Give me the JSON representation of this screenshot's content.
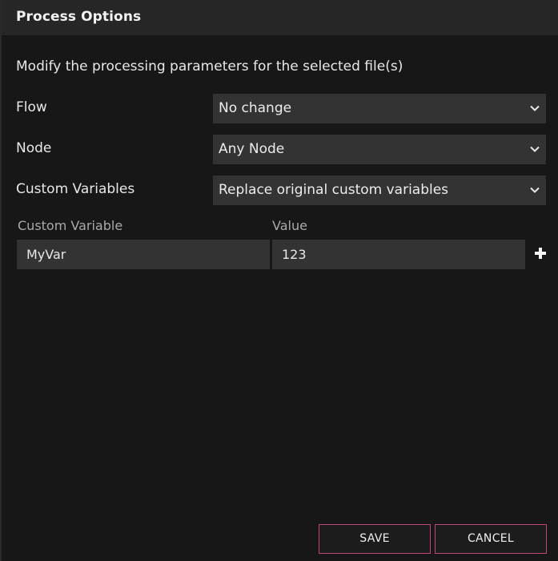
{
  "dialog": {
    "title": "Process Options",
    "description": "Modify the processing parameters for the selected file(s)"
  },
  "fields": {
    "flow": {
      "label": "Flow",
      "value": "No change"
    },
    "node": {
      "label": "Node",
      "value": "Any Node"
    },
    "custom_variables": {
      "label": "Custom Variables",
      "value": "Replace original custom variables"
    }
  },
  "variables_table": {
    "col_variable": "Custom Variable",
    "col_value": "Value",
    "rows": [
      {
        "name": "MyVar",
        "value": "123"
      }
    ]
  },
  "buttons": {
    "save": "SAVE",
    "cancel": "CANCEL"
  },
  "icons": {
    "dropdown": "chevron-down-icon",
    "add": "plus-icon"
  },
  "colors": {
    "accent_border": "#c2447a",
    "background": "#171717",
    "header": "#262626",
    "field": "#333333"
  }
}
